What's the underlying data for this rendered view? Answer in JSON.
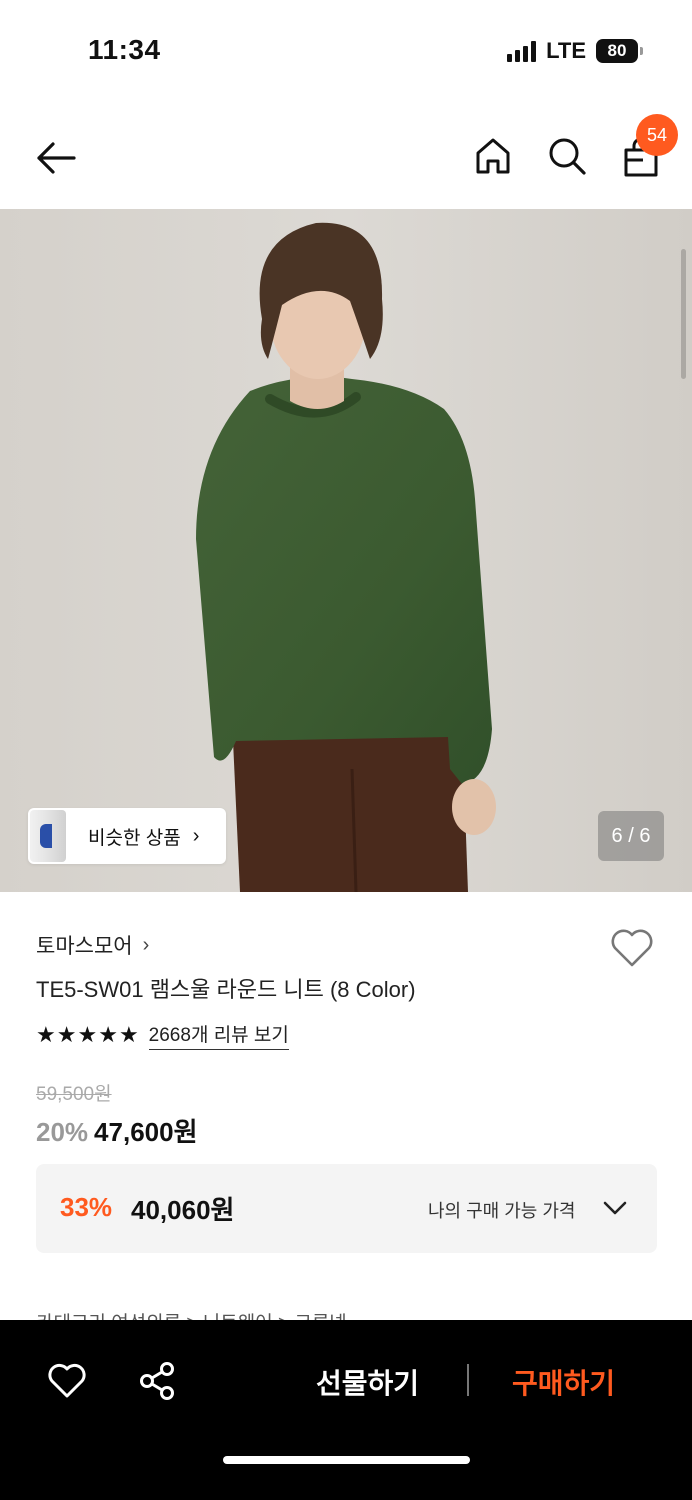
{
  "status_bar": {
    "time": "11:34",
    "network": "LTE",
    "battery": "80"
  },
  "nav": {
    "cart_count": "54"
  },
  "hero": {
    "similar_label": "비슷한 상품",
    "image_counter": "6 / 6"
  },
  "product": {
    "brand": "토마스모어",
    "title": "TE5-SW01 램스울 라운드 니트 (8 Color)",
    "rating_stars": 5,
    "review_link": "2668개 리뷰 보기",
    "original_price": "59,500원",
    "discount": "20%",
    "sale_price": "47,600원"
  },
  "my_price": {
    "discount": "33%",
    "price": "40,060원",
    "label": "나의 구매 가능 가격"
  },
  "category_peek": "카테고리      여성의류 > 니트웨어 > 크루넥",
  "bottom_bar": {
    "gift_label": "선물하기",
    "buy_label": "구매하기"
  },
  "colors": {
    "accent": "#ff5a1f",
    "sweater": "#3d5a2e",
    "trousers": "#4a2a1c"
  },
  "icons": [
    "back-arrow-icon",
    "home-icon",
    "search-icon",
    "shopping-bag-icon",
    "heart-icon",
    "share-icon",
    "chevron-right-icon",
    "chevron-down-icon",
    "star-icon"
  ]
}
